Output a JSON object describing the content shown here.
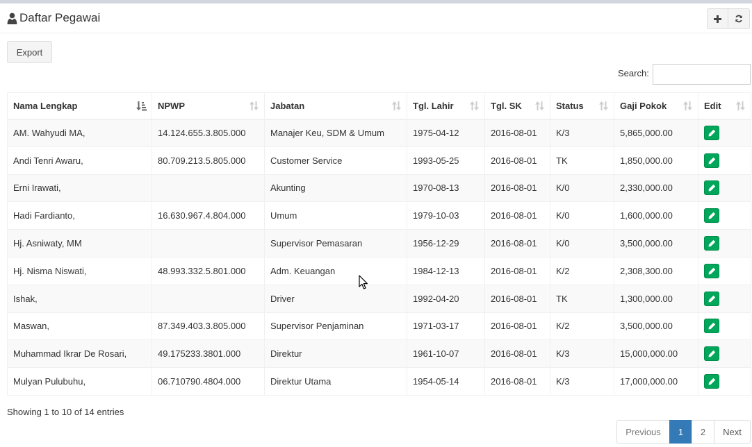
{
  "header": {
    "title": "Daftar Pegawai",
    "icon": "user-icon",
    "buttons": [
      "plus-icon",
      "refresh-icon"
    ]
  },
  "toolbar": {
    "export_label": "Export"
  },
  "search": {
    "label": "Search:",
    "value": ""
  },
  "table": {
    "columns": [
      "Nama Lengkap",
      "NPWP",
      "Jabatan",
      "Tgl. Lahir",
      "Tgl. SK",
      "Status",
      "Gaji Pokok",
      "Edit"
    ],
    "rows": [
      [
        "AM. Wahyudi MA,",
        "14.124.655.3.805.000",
        "Manajer Keu, SDM & Umum",
        "1975-04-12",
        "2016-08-01",
        "K/3",
        "5,865,000.00"
      ],
      [
        "Andi Tenri Awaru,",
        "80.709.213.5.805.000",
        "Customer Service",
        "1993-05-25",
        "2016-08-01",
        "TK",
        "1,850,000.00"
      ],
      [
        "Erni Irawati,",
        "",
        "Akunting",
        "1970-08-13",
        "2016-08-01",
        "K/0",
        "2,330,000.00"
      ],
      [
        "Hadi Fardianto,",
        "16.630.967.4.804.000",
        "Umum",
        "1979-10-03",
        "2016-08-01",
        "K/0",
        "1,600,000.00"
      ],
      [
        "Hj. Asniwaty, MM",
        "",
        "Supervisor Pemasaran",
        "1956-12-29",
        "2016-08-01",
        "K/0",
        "3,500,000.00"
      ],
      [
        "Hj. Nisma Niswati,",
        "48.993.332.5.801.000",
        "Adm. Keuangan",
        "1984-12-13",
        "2016-08-01",
        "K/2",
        "2,308,300.00"
      ],
      [
        "Ishak,",
        "",
        "Driver",
        "1992-04-20",
        "2016-08-01",
        "TK",
        "1,300,000.00"
      ],
      [
        "Maswan,",
        "87.349.403.3.805.000",
        "Supervisor Penjaminan",
        "1971-03-17",
        "2016-08-01",
        "K/2",
        "3,500,000.00"
      ],
      [
        "Muhammad Ikrar De Rosari,",
        "49.175233.3801.000",
        "Direktur",
        "1961-10-07",
        "2016-08-01",
        "K/3",
        "15,000,000.00"
      ],
      [
        "Mulyan Pulubuhu,",
        "06.710790.4804.000",
        "Direktur Utama",
        "1954-05-14",
        "2016-08-01",
        "K/3",
        "17,000,000.00"
      ]
    ]
  },
  "info_text": "Showing 1 to 10 of 14 entries",
  "pagination": {
    "previous": "Previous",
    "pages": [
      "1",
      "2"
    ],
    "current": "1",
    "next": "Next"
  },
  "colors": {
    "edit_button": "#00a65a",
    "active_page": "#337ab7",
    "header_border": "#d2d6de"
  }
}
